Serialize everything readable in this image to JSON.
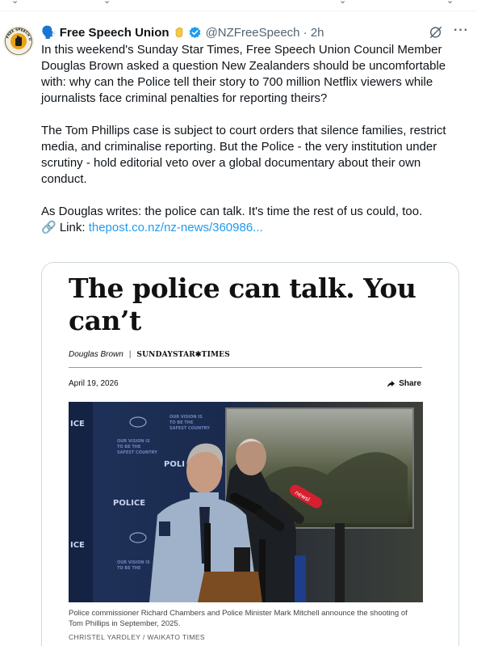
{
  "tweet": {
    "author_emoji": "🗣️",
    "author_name": "Free Speech Union",
    "handle_time": "@NZFreeSpeech · 2h",
    "paragraphs": [
      "In this weekend's Sunday Star Times, Free Speech Union Council Member Douglas Brown asked a question New Zealanders should be uncomfortable with: why can the Police tell their story to 700 million Netflix viewers while journalists face criminal penalties for reporting theirs?",
      "The Tom Phillips case is subject to court orders that silence families, restrict media, and criminalise reporting. But the Police - the very institution under scrutiny - hold editorial veto over a global documentary about their own conduct.",
      "As Douglas writes: the police can talk. It's time the rest of us could, too."
    ],
    "link_prefix": "🔗 Link: ",
    "link_text": "thepost.co.nz/nz-news/360986..."
  },
  "icons": {
    "avatar": "free-speech-union-logo",
    "verified": "verified-badge-icon",
    "grok": "grok-icon",
    "more": "more-icon",
    "share": "share-icon"
  },
  "card": {
    "headline": "The police can talk. You can’t",
    "author": "Douglas Brown",
    "separator": "|",
    "publication": "SUNDAYSTAR✱TIMES",
    "date": "April 19, 2026",
    "share_label": "Share",
    "caption": "Police commissioner Richard Chambers and Police Minister Mark Mitchell announce the shooting of Tom Phillips in September, 2025.",
    "credit": "CHRISTEL YARDLEY / WAIKATO TIMES"
  },
  "colors": {
    "link": "#1d9bf0",
    "verified": "#1d9bf0",
    "muted": "#536471"
  }
}
